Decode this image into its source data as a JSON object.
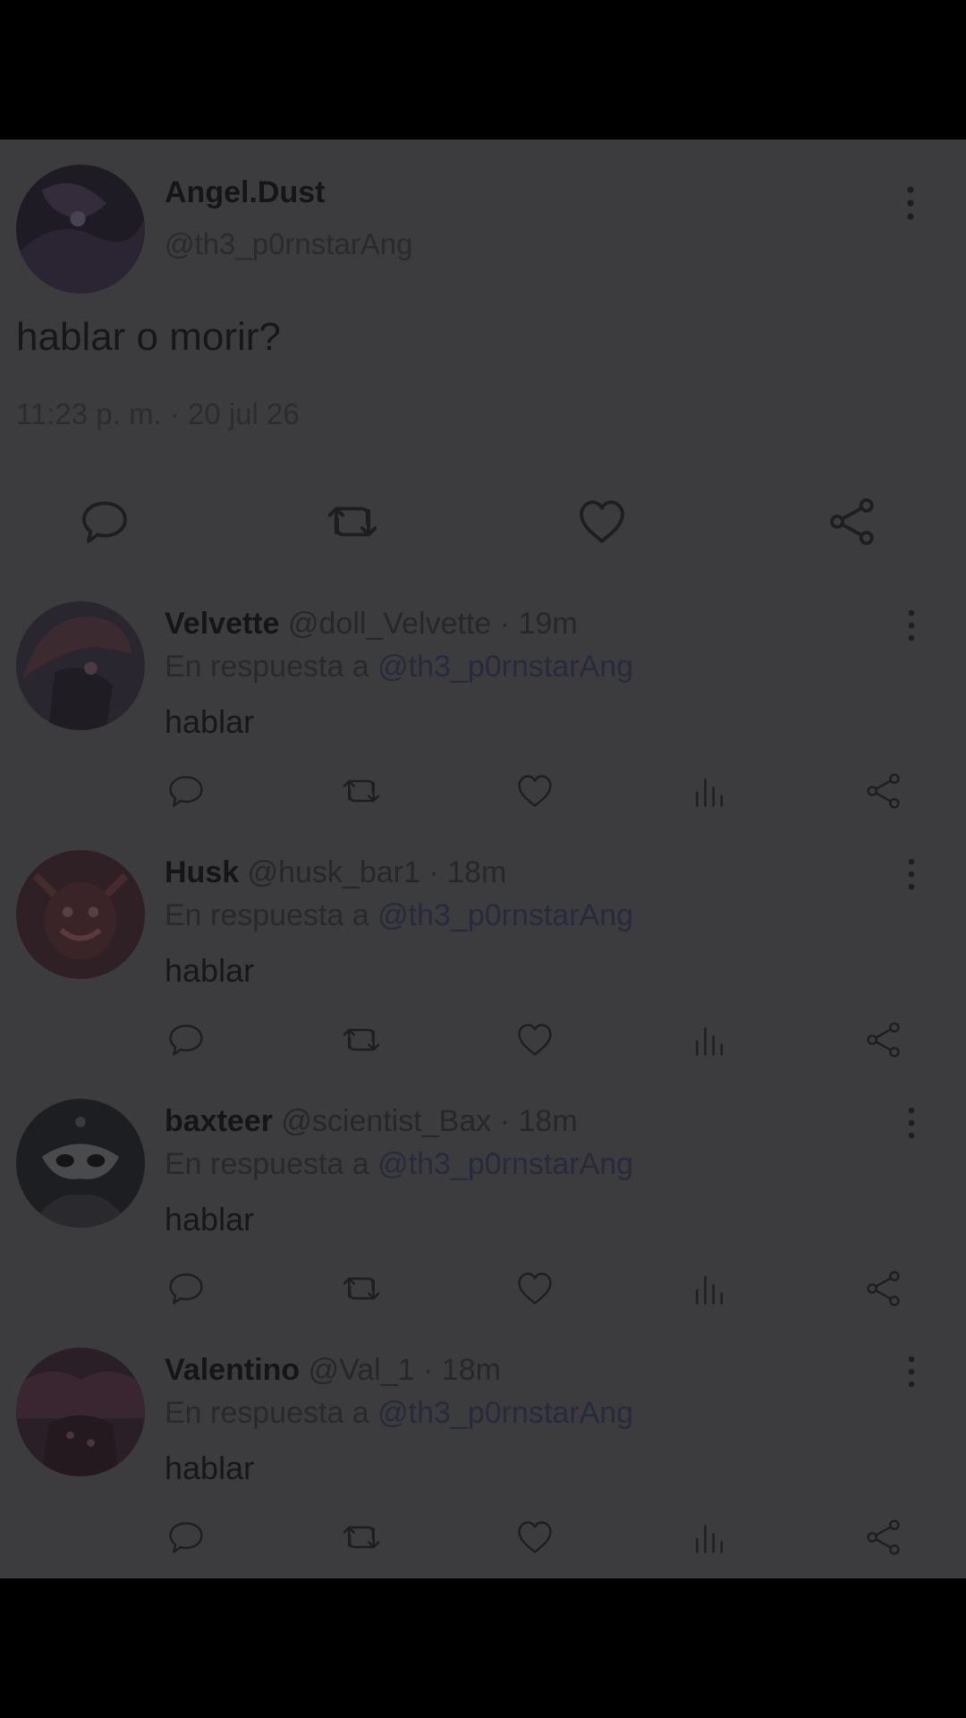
{
  "tweet": {
    "author_name": "Angel.Dust",
    "author_handle": "@th3_p0rnstarAng",
    "text": "hablar o morir?",
    "time": "11:23 p. m.",
    "separator": "·",
    "date": "20 jul 26",
    "icons": [
      "reply-icon",
      "retweet-icon",
      "like-icon",
      "share-icon",
      "more-vertical-icon"
    ]
  },
  "replies": [
    {
      "name": "Velvette",
      "handle": "@doll_Velvette",
      "separator": "·",
      "time": "19m",
      "replying_prefix": "En respuesta a",
      "replying_to": "@th3_p0rnstarAng",
      "text": "hablar"
    },
    {
      "name": "Husk",
      "handle": "@husk_bar1",
      "separator": "·",
      "time": "18m",
      "replying_prefix": "En respuesta a",
      "replying_to": "@th3_p0rnstarAng",
      "text": "hablar"
    },
    {
      "name": "baxteer",
      "handle": "@scientist_Bax",
      "separator": "·",
      "time": "18m",
      "replying_prefix": "En respuesta a",
      "replying_to": "@th3_p0rnstarAng",
      "text": "hablar"
    },
    {
      "name": "Valentino",
      "handle": "@Val_1",
      "separator": "·",
      "time": "18m",
      "replying_prefix": "En respuesta a",
      "replying_to": "@th3_p0rnstarAng",
      "text": "hablar"
    }
  ],
  "colors": {
    "screen_background": "#3c3c3e",
    "letterbox": "#000000",
    "text_primary": "#151517",
    "text_secondary": "#2a2a2d"
  }
}
